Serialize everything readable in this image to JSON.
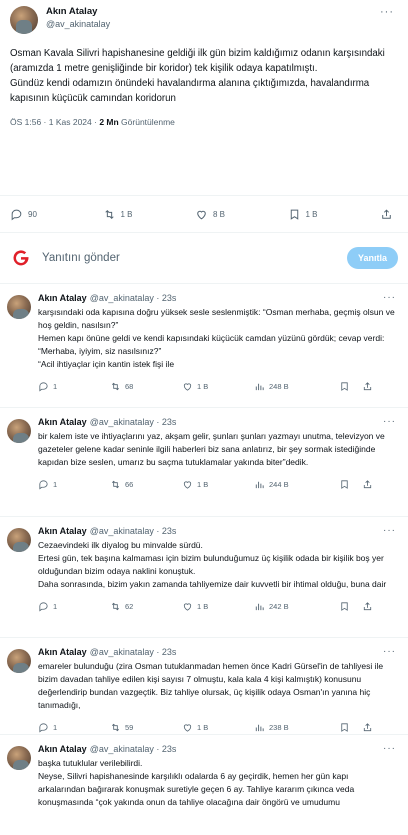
{
  "main_tweet": {
    "name": "Akın Atalay",
    "handle": "@av_akinatalay",
    "text": "Osman Kavala Silivri hapishanesine geldiği ilk gün bizim kaldığımız odanın karşısındaki (aramızda 1 metre genişliğinde bir koridor) tek kişilik odaya kapatılmıştı.\nGündüz kendi odamızın önündeki havalandırma alanına çıktığımızda, havalandırma kapısının küçücük camından koridorun",
    "time": "ÖS 1:56 · 1 Kas 2024 · ",
    "views_count": "2 Mn",
    "views_label": " Görüntülenme",
    "replies": "90",
    "retweets": "1 B",
    "likes": "8 B",
    "bookmarks": "1 B"
  },
  "reply_box": {
    "placeholder": "Yanıtını gönder",
    "button": "Yanıtla"
  },
  "thread": [
    {
      "name": "Akın Atalay",
      "handle": "@av_akinatalay · 23s",
      "text": "karşısındaki oda kapısına doğru yüksek sesle seslenmiştik: “Osman merhaba, geçmiş olsun ve hoş geldin, nasılsın?”\nHemen kapı önüne geldi ve kendi kapısındaki küçücük camdan yüzünü gördük; cevap verdi: “Merhaba, iyiyim, siz nasılsınız?”\n“Acil ihtiyaçlar için kantin istek fişi ile",
      "replies": "1",
      "retweets": "68",
      "likes": "1 B",
      "views": "248 B"
    },
    {
      "name": "Akın Atalay",
      "handle": "@av_akinatalay · 23s",
      "text": "bir kalem iste ve ihtiyaçlarını yaz, akşam gelir, şunları şunları yazmayı unutma, televizyon ve gazeteler gelene kadar seninle ilgili haberleri biz sana anlatırız, bir şey sormak istediğinde kapıdan bize seslen, umarız bu saçma tutuklamalar yakında biter”dedik.",
      "replies": "1",
      "retweets": "66",
      "likes": "1 B",
      "views": "244 B"
    },
    {
      "name": "Akın Atalay",
      "handle": "@av_akinatalay · 23s",
      "text": "Cezaevindeki ilk diyalog bu minvalde sürdü.\nErtesi gün, tek başına kalmaması için bizim bulunduğumuz üç kişilik odada bir kişilik boş yer olduğundan bizim odaya naklini konuştuk.\nDaha sonrasında, bizim yakın zamanda tahliyemize dair kuvvetli bir ihtimal olduğu, buna dair",
      "replies": "1",
      "retweets": "62",
      "likes": "1 B",
      "views": "242 B"
    },
    {
      "name": "Akın Atalay",
      "handle": "@av_akinatalay · 23s",
      "text": "emareler bulunduğu (zira Osman tutuklanmadan hemen önce Kadri Gürsel'in de tahliyesi ile bizim davadan tahliye edilen kişi sayısı 7 olmuştu, kala kala 4 kişi kalmıştık) konusunu değerlendirip bundan vazgeçtik. Biz tahliye olursak, üç kişilik odaya Osman'ın yanına hiç tanımadığı,",
      "replies": "1",
      "retweets": "59",
      "likes": "1 B",
      "views": "238 B"
    },
    {
      "name": "Akın Atalay",
      "handle": "@av_akinatalay · 23s",
      "text": "başka tutuklular verilebilirdi.\nNeyse, Silivri hapishanesinde karşılıklı odalarda 6 ay geçirdik, hemen her gün kapı arkalarından bağırarak konuşmak suretiyle geçen 6 ay. Tahliye kararım çıkınca veda konuşmasında “çok yakında onun da tahliye olacağına dair öngörü ve umudumu",
      "replies": "",
      "retweets": "",
      "likes": "",
      "views": ""
    }
  ]
}
